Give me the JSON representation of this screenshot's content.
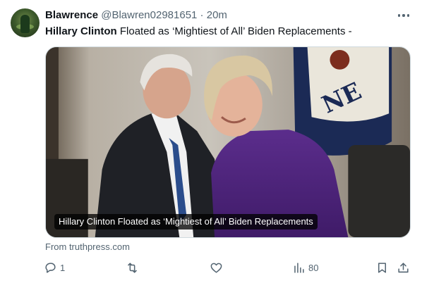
{
  "tweet": {
    "display_name": "Blawrence",
    "handle": "@Blawren02981651",
    "separator": " · ",
    "time": "20m",
    "text_bold": "Hillary Clinton",
    "text_rest": " Floated as ‘Mightiest of All’ Biden Replacements -"
  },
  "card": {
    "caption": "Hillary Clinton Floated as ‘Mightiest of All’ Biden Replacements",
    "source": "From truthpress.com",
    "image_flag_text": "NE"
  },
  "actions": {
    "reply_count": "1",
    "views_count": "80"
  },
  "icons": {
    "more": "more-horizontal-icon",
    "reply": "reply-icon",
    "repost": "repost-icon",
    "like": "heart-icon",
    "views": "views-bar-chart-icon",
    "bookmark": "bookmark-icon",
    "share": "share-icon"
  },
  "colors": {
    "text_primary": "#0f1419",
    "text_secondary": "#536471",
    "card_border": "#cfd9de"
  }
}
